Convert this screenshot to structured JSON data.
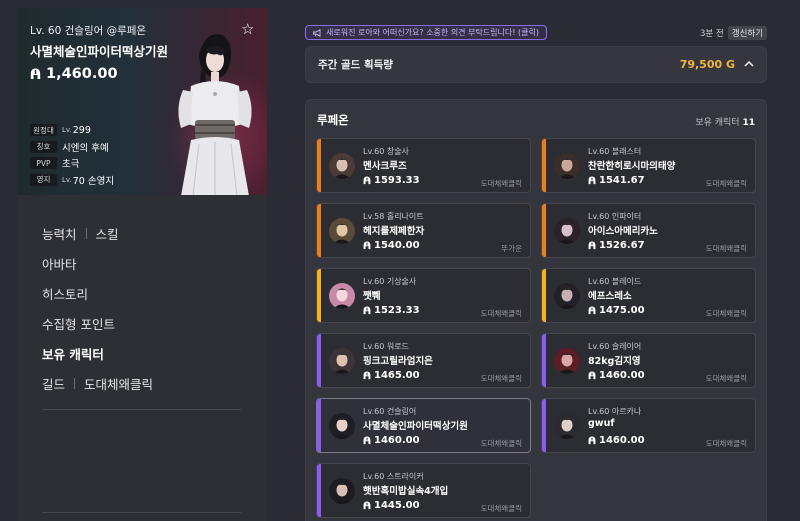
{
  "hero": {
    "level_line": "Lv. 60 건슬링어 @루페온",
    "name": "사멸체술인파이터떡상기원",
    "gold": "1,460.00",
    "stats": [
      {
        "key": "원정대",
        "prefix": "Lv.",
        "value": "299"
      },
      {
        "key": "칭호",
        "prefix": "",
        "value": "시엔의 후예"
      },
      {
        "key": "PVP",
        "prefix": "",
        "value": "초극"
      },
      {
        "key": "영지",
        "prefix": "Lv.",
        "value": "70 손영지"
      }
    ]
  },
  "menu": {
    "stats_label": "능력치",
    "skill_label": "스킬",
    "avatar_label": "아바타",
    "history_label": "히스토리",
    "collect_label": "수집형 포인트",
    "characters_label": "보유 캐릭터",
    "guild_label": "길드",
    "guild_name": "도대체왜클릭"
  },
  "notice": "새로워진 로아와 어떠신가요? 소중한 의견 부탁드립니다! (클릭)",
  "updated": {
    "time": "3분 전",
    "refresh_label": "갱신하기"
  },
  "weekly_gold": {
    "title": "주간 골드 획득량",
    "value": "79,500 G"
  },
  "server": {
    "name": "루페온",
    "owned_label": "보유 캐릭터",
    "owned_count": "11"
  },
  "colors": {
    "orange": "#f07d1a",
    "yellow": "#f5b21a",
    "purple": "#8b5cf6",
    "gold": "#f1b43a"
  },
  "characters": [
    {
      "level": "Lv.60 창술사",
      "name": "멘사크루즈",
      "gold": "1593.33",
      "guild": "도대체왜클릭",
      "tier": "orange"
    },
    {
      "level": "Lv.60 블래스터",
      "name": "찬란한히로시마의태양",
      "gold": "1541.67",
      "guild": "도대체왜클릭",
      "tier": "orange"
    },
    {
      "level": "Lv.58 홀리나이트",
      "name": "헤지를제페한자",
      "gold": "1540.00",
      "guild": "뚜가운",
      "tier": "orange"
    },
    {
      "level": "Lv.60 인파이터",
      "name": "아이스아메리카노",
      "gold": "1526.67",
      "guild": "도대체왜클릭",
      "tier": "orange"
    },
    {
      "level": "Lv.60 기상술사",
      "name": "쨋쀄",
      "gold": "1523.33",
      "guild": "도대체왜클릭",
      "tier": "yellow"
    },
    {
      "level": "Lv.60 블레이드",
      "name": "에프스레소",
      "gold": "1475.00",
      "guild": "도대체왜클릭",
      "tier": "yellow"
    },
    {
      "level": "Lv.60 워로드",
      "name": "핑크고릴라엄지은",
      "gold": "1465.00",
      "guild": "도대체왜클릭",
      "tier": "purple"
    },
    {
      "level": "Lv.60 슬레이어",
      "name": "82kg김지영",
      "gold": "1460.00",
      "guild": "도대체왜클릭",
      "tier": "purple"
    },
    {
      "level": "Lv.60 건슬링어",
      "name": "사멸체술인파이터떡상기원",
      "gold": "1460.00",
      "guild": "도대체왜클릭",
      "tier": "purple"
    },
    {
      "level": "Lv.60 아르카나",
      "name": "gwuf",
      "gold": "1460.00",
      "guild": "도대체왜클릭",
      "tier": "purple"
    },
    {
      "level": "Lv.60 스트라이커",
      "name": "햇반혹미밥실속4개입",
      "gold": "1445.00",
      "guild": "도대체왜클릭",
      "tier": "purple"
    }
  ]
}
